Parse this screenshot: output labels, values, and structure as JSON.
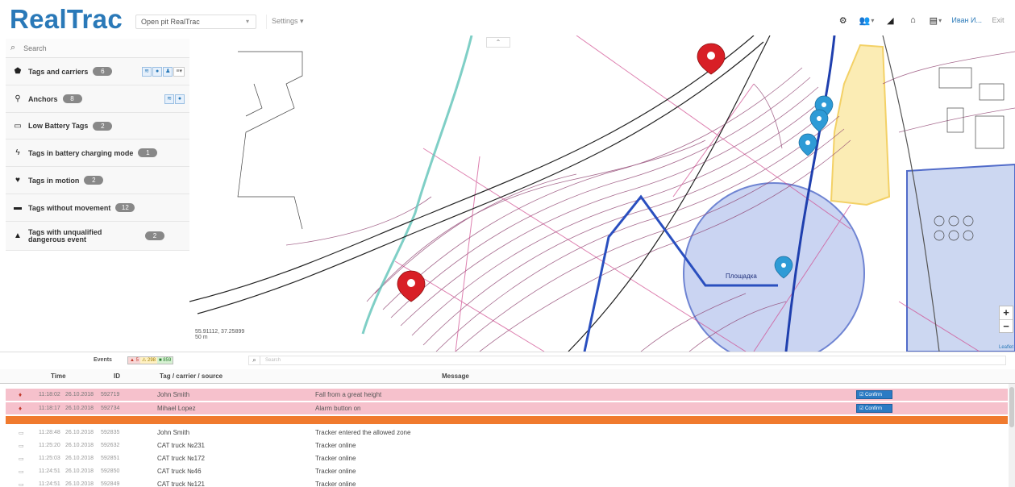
{
  "app": {
    "title": "RealTrac",
    "project": "Open pit RealTrac",
    "settings_label": "Settings ▾",
    "user": "Иван И...",
    "exit_label": "Exit"
  },
  "left_panel": {
    "search_placeholder": "Search",
    "groups": [
      {
        "icon": "tags-icon",
        "glyph": "🏷",
        "label": "Tags and carriers",
        "count": "6"
      },
      {
        "icon": "anchor-pin-icon",
        "glyph": "⚲",
        "label": "Anchors",
        "count": "8"
      },
      {
        "icon": "battery-low-icon",
        "glyph": "▭",
        "label": "Low Battery Tags",
        "count": "2"
      },
      {
        "icon": "lightning-icon",
        "glyph": "ϟ",
        "label": "Tags in battery charging mode",
        "count": "1"
      },
      {
        "icon": "heartbeat-icon",
        "glyph": "♥",
        "label": "Tags in motion",
        "count": "2"
      },
      {
        "icon": "bed-icon",
        "glyph": "▬",
        "label": "Tags without movement",
        "count": "12"
      },
      {
        "icon": "warning-icon",
        "glyph": "▲",
        "label": "Tags with unqualified dangerous event",
        "count": "2"
      }
    ]
  },
  "map": {
    "coords_line1": "55.91112, 37.25899",
    "coords_line2": "50 m",
    "attribution": "Leaflet",
    "zoom_in": "+",
    "zoom_out": "−",
    "label_zone": "Площадка"
  },
  "events": {
    "title": "Events",
    "filters": [
      "▲ 5",
      "⚠ 298",
      "■ 859"
    ],
    "search_placeholder": "Search",
    "columns": {
      "time": "Time",
      "id": "ID",
      "tag": "Tag / carrier / source",
      "message": "Message"
    },
    "confirm_label": "☑ Confirm",
    "rows": [
      {
        "kind": "alarm",
        "icon": "▲",
        "time": "11:18:02",
        "date": "26.10.2018",
        "id": "592719",
        "tag": "John Smith",
        "message": "Fall from a great height"
      },
      {
        "kind": "alarm",
        "icon": "▲",
        "time": "11:18:17",
        "date": "26.10.2018",
        "id": "592734",
        "tag": "Mihael Lopez",
        "message": "Alarm button on"
      },
      {
        "kind": "info",
        "icon": "▭",
        "time": "11:28:48",
        "date": "26.10.2018",
        "id": "592835",
        "tag": "John Smith",
        "message": "Tracker entered the allowed zone"
      },
      {
        "kind": "info",
        "icon": "▭",
        "time": "11:25:20",
        "date": "26.10.2018",
        "id": "592632",
        "tag": "CAT truck №231",
        "message": "Tracker online"
      },
      {
        "kind": "info",
        "icon": "▭",
        "time": "11:25:03",
        "date": "26.10.2018",
        "id": "592851",
        "tag": "CAT truck №172",
        "message": "Tracker online"
      },
      {
        "kind": "info",
        "icon": "▭",
        "time": "11:24:51",
        "date": "26.10.2018",
        "id": "592850",
        "tag": "CAT truck №46",
        "message": "Tracker online"
      },
      {
        "kind": "info",
        "icon": "▭",
        "time": "11:24:51",
        "date": "26.10.2018",
        "id": "592849",
        "tag": "CAT truck №121",
        "message": "Tracker online"
      }
    ]
  },
  "colors": {
    "brand": "#2a79b8",
    "alarm_row": "#f6c1cc",
    "orange_bar": "#f07a2e",
    "confirm_button": "#2b7bc4",
    "marker_red": "#d81f26",
    "marker_blue": "#2e9bd6",
    "zone_blue": "#3f5cc4",
    "zone_yellow": "#f2c94c"
  }
}
